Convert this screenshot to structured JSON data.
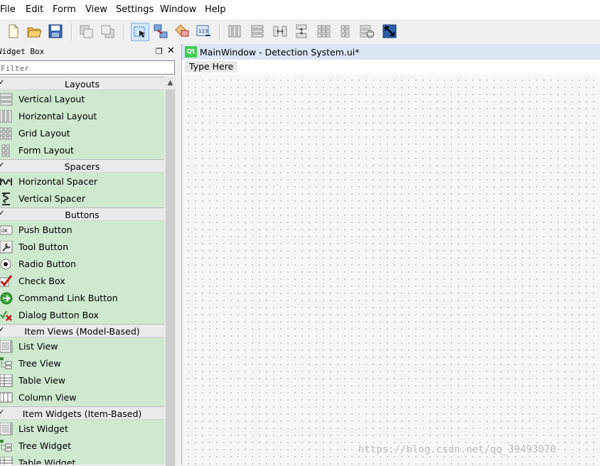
{
  "menubar": {
    "items": [
      "File",
      "Edit",
      "Form",
      "View",
      "Settings",
      "Window",
      "Help"
    ]
  },
  "toolbar": {
    "buttons": [
      "new-icon",
      "open-icon",
      "save-icon",
      "send-to-back-icon",
      "bring-to-front-icon",
      "edit-widgets-icon",
      "edit-signals-slots-icon",
      "edit-buddies-icon",
      "edit-tab-order-icon",
      "lay-out-horizontally-icon",
      "lay-out-vertically-icon",
      "horizontal-splitter-icon",
      "vertical-splitter-icon",
      "grid-layout-icon",
      "form-layout-icon",
      "break-layout-icon",
      "adjust-size-icon"
    ]
  },
  "widget_box": {
    "title": "Widget Box",
    "filter_placeholder": "Filter",
    "categories": [
      {
        "label": "Layouts",
        "items": [
          "Vertical Layout",
          "Horizontal Layout",
          "Grid Layout",
          "Form Layout"
        ]
      },
      {
        "label": "Spacers",
        "items": [
          "Horizontal Spacer",
          "Vertical Spacer"
        ]
      },
      {
        "label": "Buttons",
        "items": [
          "Push Button",
          "Tool Button",
          "Radio Button",
          "Check Box",
          "Command Link Button",
          "Dialog Button Box"
        ]
      },
      {
        "label": "Item Views (Model-Based)",
        "items": [
          "List View",
          "Tree View",
          "Table View",
          "Column View"
        ]
      },
      {
        "label": "Item Widgets (Item-Based)",
        "items": [
          "List Widget",
          "Tree Widget",
          "Table Widget"
        ]
      }
    ]
  },
  "form_window": {
    "logo": "Qt",
    "title": "MainWindow - Detection System.ui*",
    "menu_placeholder": "Type Here"
  },
  "watermark": "https://blog.csdn.net/qq_39493070",
  "colors": {
    "widget_list_bg": "#cfe8d0",
    "category_header_bg": "#eaeaea",
    "form_title_bg": "#dbe6f3",
    "qt_green": "#41cd52"
  }
}
